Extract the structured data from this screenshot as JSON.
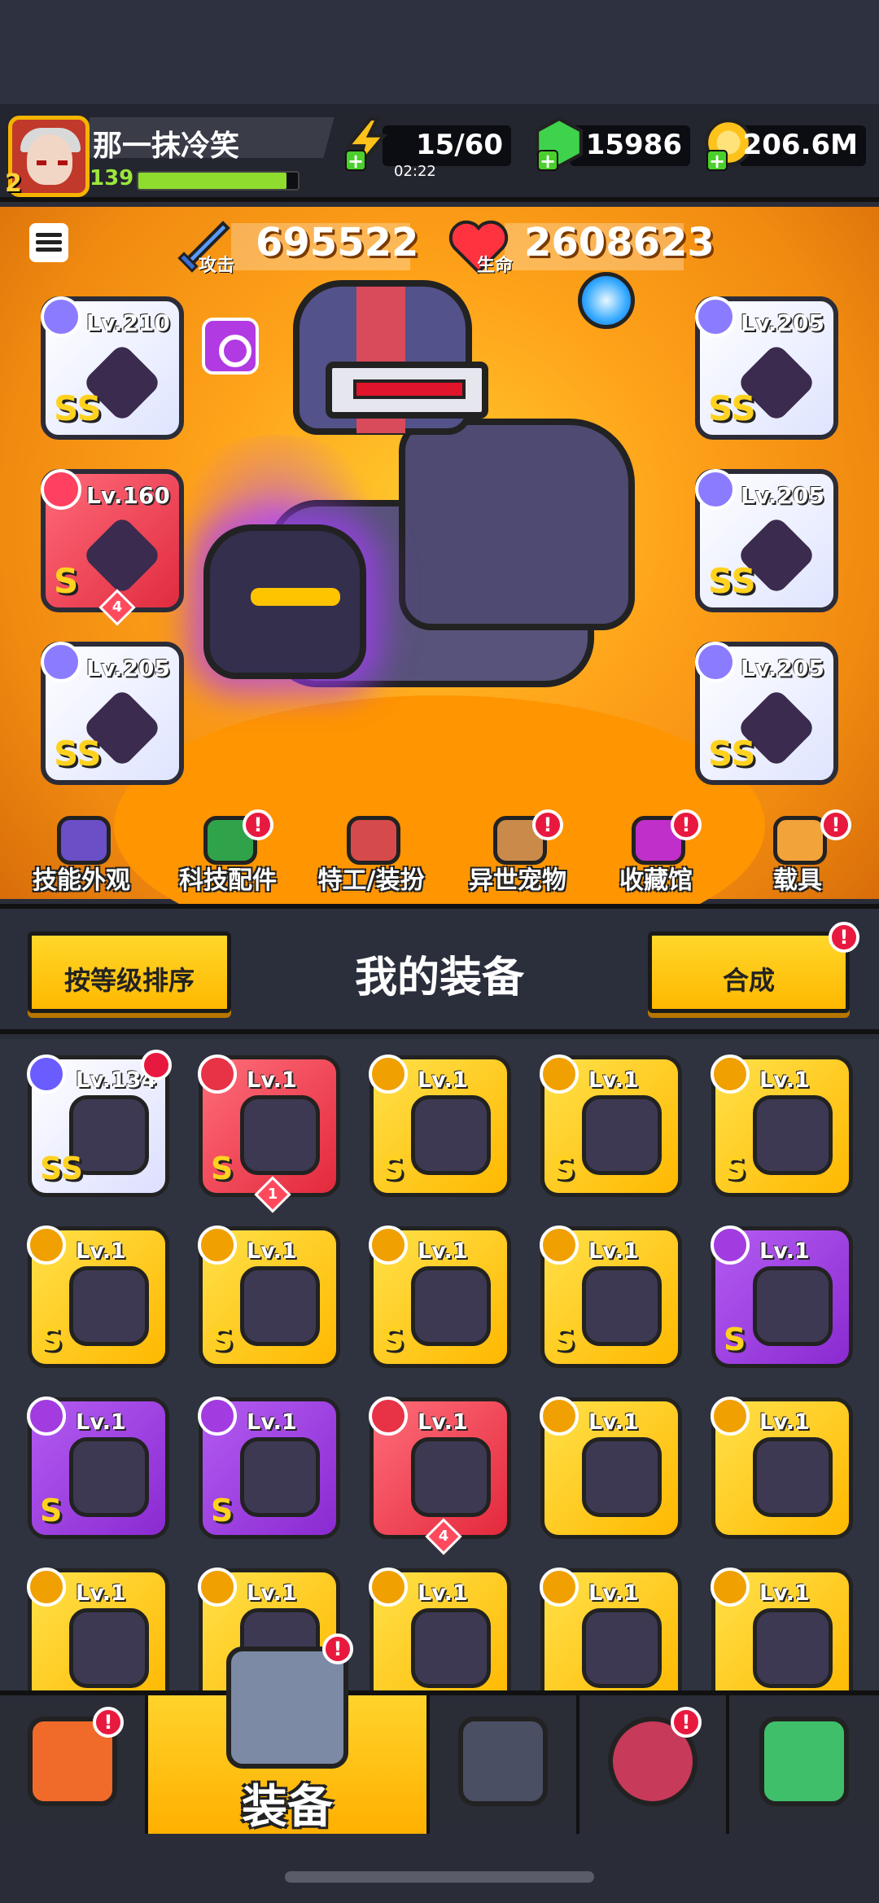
{
  "player": {
    "name": "那一抹冷笑",
    "vip_level": "2",
    "level": "139",
    "xp_fraction": 0.93
  },
  "resources": {
    "energy": {
      "value": "15/60",
      "timer": "02:22"
    },
    "gems": {
      "value": "15986"
    },
    "gold": {
      "value": "206.6M"
    }
  },
  "stats": {
    "attack_label": "攻击",
    "attack_value": "695522",
    "hp_label": "生命",
    "hp_value": "2608623"
  },
  "equipped": [
    {
      "level": "Lv.210",
      "grade": "SS",
      "rarity": "white"
    },
    {
      "level": "Lv.160",
      "grade": "S",
      "rarity": "red",
      "stars": "4"
    },
    {
      "level": "Lv.205",
      "grade": "SS",
      "rarity": "white"
    },
    {
      "level": "Lv.205",
      "grade": "SS",
      "rarity": "white"
    },
    {
      "level": "Lv.205",
      "grade": "SS",
      "rarity": "white"
    },
    {
      "level": "Lv.205",
      "grade": "SS",
      "rarity": "white"
    }
  ],
  "features": [
    {
      "label": "技能外观",
      "badge": false,
      "color": "#6a4fc7"
    },
    {
      "label": "科技配件",
      "badge": true,
      "color": "#2fa24a"
    },
    {
      "label": "特工/装扮",
      "badge": false,
      "color": "#d54b4b"
    },
    {
      "label": "异世宠物",
      "badge": true,
      "color": "#c98a4a"
    },
    {
      "label": "收藏馆",
      "badge": true,
      "color": "#c02fc9"
    },
    {
      "label": "载具",
      "badge": true,
      "color": "#f2a33a"
    }
  ],
  "inventory_header": {
    "sort_label": "按等级排序",
    "title": "我的装备",
    "merge_label": "合成"
  },
  "inventory": [
    {
      "level": "Lv.134",
      "grade": "SS",
      "rarity": "white",
      "hot": true
    },
    {
      "level": "Lv.1",
      "grade": "S",
      "rarity": "red",
      "stars": "1"
    },
    {
      "level": "Lv.1",
      "grade": "S",
      "rarity": "yellow"
    },
    {
      "level": "Lv.1",
      "grade": "S",
      "rarity": "yellow"
    },
    {
      "level": "Lv.1",
      "grade": "S",
      "rarity": "yellow"
    },
    {
      "level": "Lv.1",
      "grade": "S",
      "rarity": "yellow"
    },
    {
      "level": "Lv.1",
      "grade": "S",
      "rarity": "yellow"
    },
    {
      "level": "Lv.1",
      "grade": "S",
      "rarity": "yellow"
    },
    {
      "level": "Lv.1",
      "grade": "S",
      "rarity": "yellow"
    },
    {
      "level": "Lv.1",
      "grade": "S",
      "rarity": "purple"
    },
    {
      "level": "Lv.1",
      "grade": "S",
      "rarity": "purple"
    },
    {
      "level": "Lv.1",
      "grade": "S",
      "rarity": "purple"
    },
    {
      "level": "Lv.1",
      "grade": "",
      "rarity": "red",
      "stars": "4"
    },
    {
      "level": "Lv.1",
      "grade": "",
      "rarity": "yellow"
    },
    {
      "level": "Lv.1",
      "grade": "",
      "rarity": "yellow"
    },
    {
      "level": "Lv.1",
      "grade": "",
      "rarity": "yellow"
    },
    {
      "level": "Lv.1",
      "grade": "",
      "rarity": "yellow"
    },
    {
      "level": "Lv.1",
      "grade": "",
      "rarity": "yellow"
    },
    {
      "level": "Lv.1",
      "grade": "",
      "rarity": "yellow"
    },
    {
      "level": "Lv.1",
      "grade": "",
      "rarity": "yellow"
    }
  ],
  "bottom_nav": [
    {
      "icon": "shop-icon",
      "label": "",
      "badge": true
    },
    {
      "icon": "equipment-icon",
      "label": "装备",
      "badge": true,
      "active": true
    },
    {
      "icon": "battle-icon",
      "label": "",
      "badge": false
    },
    {
      "icon": "planet-icon",
      "label": "",
      "badge": true
    },
    {
      "icon": "dna-icon",
      "label": "",
      "badge": false
    }
  ],
  "colors": {
    "accent": "#ffb800",
    "badge": "#e8193f",
    "background": "#2a2d38"
  }
}
